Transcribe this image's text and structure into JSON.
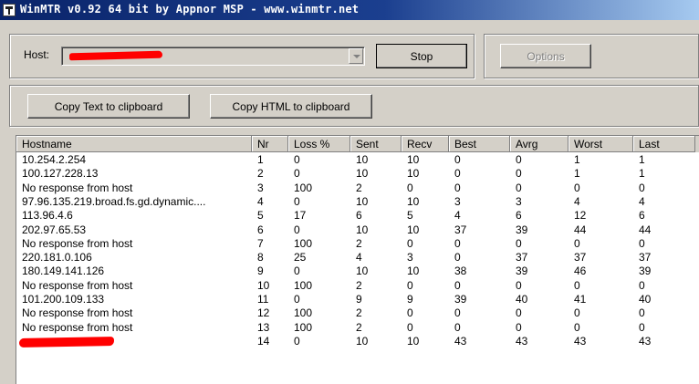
{
  "window": {
    "title": "WinMTR v0.92 64 bit by Appnor MSP - www.winmtr.net"
  },
  "host": {
    "label": "Host:",
    "value": ""
  },
  "buttons": {
    "stop": "Stop",
    "options": "Options",
    "copy_text": "Copy Text to clipboard",
    "copy_html": "Copy HTML to clipboard"
  },
  "table": {
    "columns": [
      "Hostname",
      "Nr",
      "Loss %",
      "Sent",
      "Recv",
      "Best",
      "Avrg",
      "Worst",
      "Last"
    ],
    "rows": [
      [
        "10.254.2.254",
        "1",
        "0",
        "10",
        "10",
        "0",
        "0",
        "1",
        "1"
      ],
      [
        "100.127.228.13",
        "2",
        "0",
        "10",
        "10",
        "0",
        "0",
        "1",
        "1"
      ],
      [
        "No response from host",
        "3",
        "100",
        "2",
        "0",
        "0",
        "0",
        "0",
        "0"
      ],
      [
        "97.96.135.219.broad.fs.gd.dynamic....",
        "4",
        "0",
        "10",
        "10",
        "3",
        "3",
        "4",
        "4"
      ],
      [
        "113.96.4.6",
        "5",
        "17",
        "6",
        "5",
        "4",
        "6",
        "12",
        "6"
      ],
      [
        "202.97.65.53",
        "6",
        "0",
        "10",
        "10",
        "37",
        "39",
        "44",
        "44"
      ],
      [
        "No response from host",
        "7",
        "100",
        "2",
        "0",
        "0",
        "0",
        "0",
        "0"
      ],
      [
        "220.181.0.106",
        "8",
        "25",
        "4",
        "3",
        "0",
        "37",
        "37",
        "37"
      ],
      [
        "180.149.141.126",
        "9",
        "0",
        "10",
        "10",
        "38",
        "39",
        "46",
        "39"
      ],
      [
        "No response from host",
        "10",
        "100",
        "2",
        "0",
        "0",
        "0",
        "0",
        "0"
      ],
      [
        "101.200.109.133",
        "11",
        "0",
        "9",
        "9",
        "39",
        "40",
        "41",
        "40"
      ],
      [
        "No response from host",
        "12",
        "100",
        "2",
        "0",
        "0",
        "0",
        "0",
        "0"
      ],
      [
        "No response from host",
        "13",
        "100",
        "2",
        "0",
        "0",
        "0",
        "0",
        "0"
      ],
      [
        "",
        "14",
        "0",
        "10",
        "10",
        "43",
        "43",
        "43",
        "43"
      ]
    ]
  },
  "colors": {
    "titlebar": "#0a246a",
    "face": "#d4d0c8",
    "redaction": "#ff0000"
  }
}
